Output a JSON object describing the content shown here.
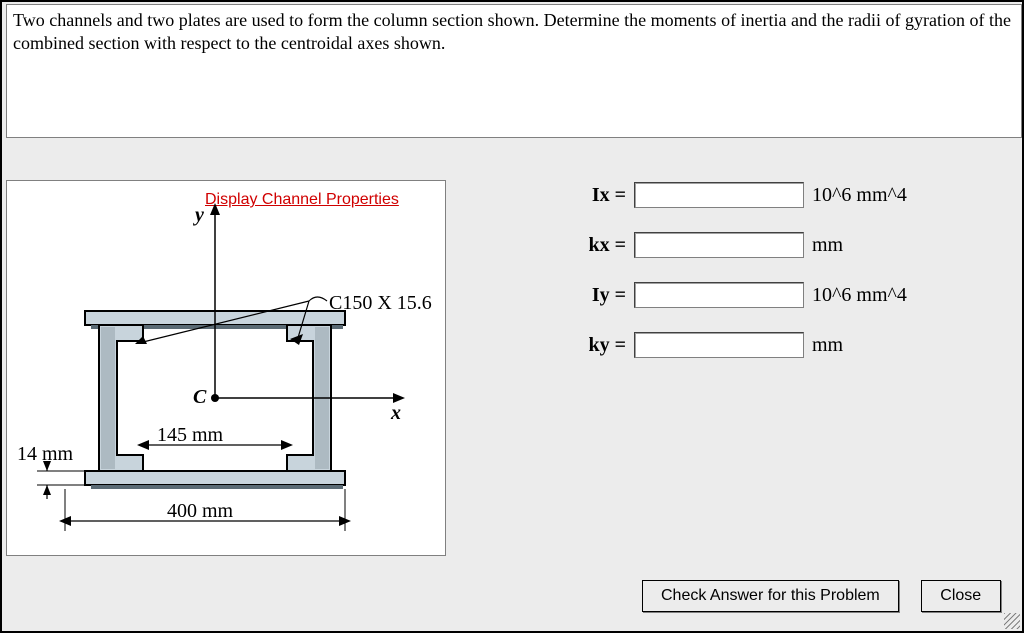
{
  "prompt": "Two channels and two plates are used to form the column section shown. Determine the moments of inertia and the radii of gyration of the combined section with respect to the centroidal axes shown.",
  "figure": {
    "link_label": "Display Channel Properties",
    "channel_label": "C150 X 15.6",
    "centroid_label": "C",
    "y_axis_label": "y",
    "x_axis_label": "x",
    "dim_left": "14 mm",
    "dim_inner_width": "145 mm",
    "dim_total_width": "400 mm"
  },
  "answers": {
    "rows": [
      {
        "label": "Ix =",
        "unit": "10^6 mm^4"
      },
      {
        "label": "kx =",
        "unit": "mm"
      },
      {
        "label": "Iy =",
        "unit": "10^6 mm^4"
      },
      {
        "label": "ky =",
        "unit": "mm"
      }
    ]
  },
  "buttons": {
    "check": "Check Answer for this Problem",
    "close": "Close"
  }
}
